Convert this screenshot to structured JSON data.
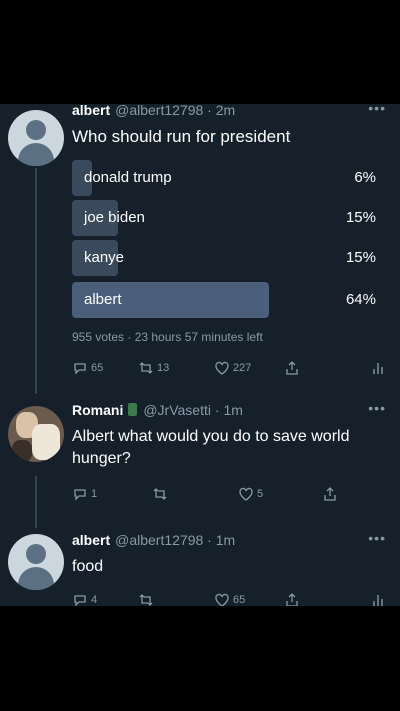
{
  "tweet1": {
    "name": "albert",
    "handle": "@albert12798",
    "time": "2m",
    "text": "Who should run for president",
    "poll": [
      {
        "label": "donald trump",
        "pct": "6%",
        "share": 0.06
      },
      {
        "label": "joe biden",
        "pct": "15%",
        "share": 0.15
      },
      {
        "label": "kanye",
        "pct": "15%",
        "share": 0.15
      },
      {
        "label": "albert",
        "pct": "64%",
        "share": 0.64
      }
    ],
    "poll_meta": "955 votes · 23 hours 57 minutes left",
    "replies": "65",
    "retweets": "13",
    "likes": "227"
  },
  "tweet2": {
    "name": "Romani",
    "handle": "@JrVasetti",
    "time": "1m",
    "text": "Albert what would you do to save world hunger?",
    "replies": "1",
    "likes": "5"
  },
  "tweet3": {
    "name": "albert",
    "handle": "@albert12798",
    "time": "1m",
    "text": "food",
    "replies": "4",
    "likes": "65"
  },
  "icons": [
    "reply-icon",
    "retweet-icon",
    "like-icon",
    "share-icon",
    "analytics-icon",
    "more-icon"
  ],
  "colors": {
    "background": "#15202b",
    "secondary_text": "#8899a6",
    "poll_bar": "#3a4a5c",
    "poll_bar_winner": "#4a5f79"
  }
}
